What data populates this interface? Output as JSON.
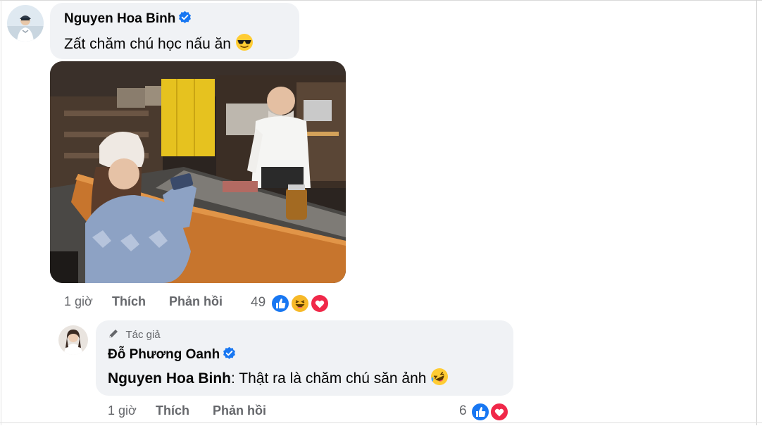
{
  "comment": {
    "author": "Nguyen Hoa Binh",
    "text": "Zất chăm chú học nấu ăn",
    "emoji_icon": "sunglasses-emoji-icon",
    "time": "1 giờ",
    "like_label": "Thích",
    "reply_label": "Phản hồi",
    "reaction_count": "49",
    "reaction_icons": [
      "like-reaction-icon",
      "haha-reaction-icon",
      "love-reaction-icon"
    ]
  },
  "reply": {
    "badge": "Tác giả",
    "author": "Đỗ Phương Oanh",
    "mention": "Nguyen Hoa Binh",
    "text": ": Thật ra là chăm chú săn ảnh",
    "emoji_icon": "rofl-emoji-icon",
    "time": "1 giờ",
    "like_label": "Thích",
    "reply_label": "Phản hồi",
    "reaction_count": "6",
    "reaction_icons": [
      "like-reaction-icon",
      "love-reaction-icon"
    ]
  },
  "colors": {
    "bubble": "#f0f2f5",
    "verified": "#1877f2",
    "like": "#1877f2",
    "love": "#f02849",
    "haha": "#f7b928",
    "meta_text": "#65676b"
  }
}
